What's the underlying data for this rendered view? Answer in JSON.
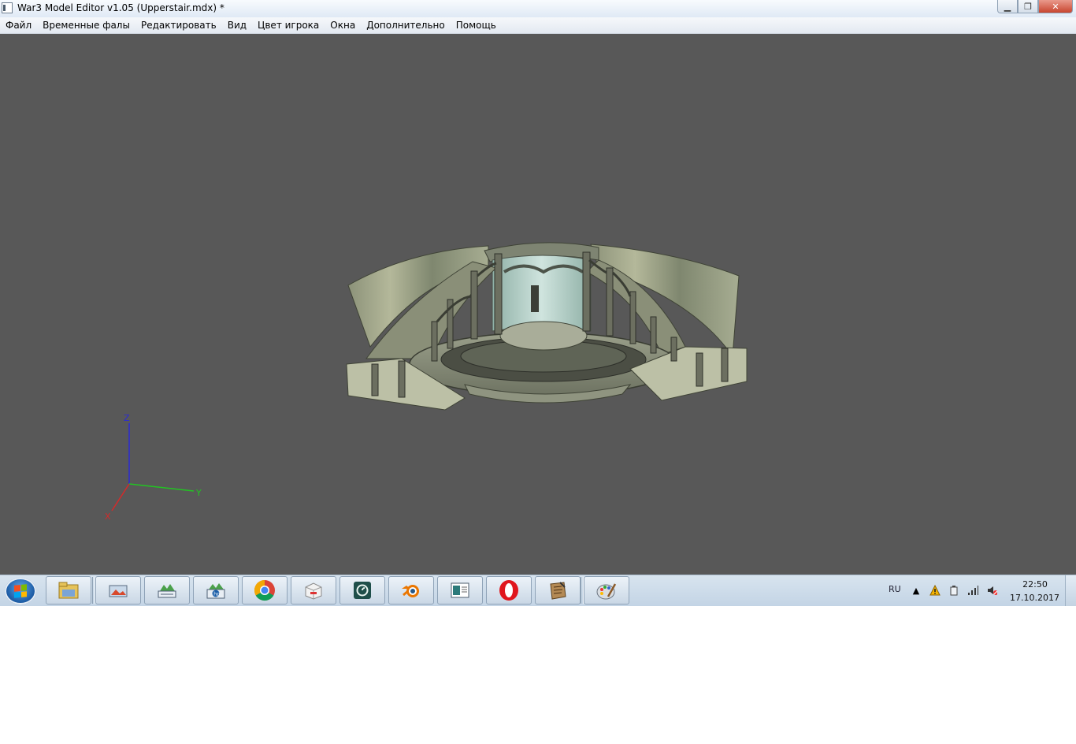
{
  "window": {
    "title": "War3 Model Editor v1.05 (Upperstair.mdx) *",
    "controls": {
      "minimize": "▁",
      "maximize": "❐",
      "close": "✕"
    }
  },
  "menu": [
    "Файл",
    "Временные фалы",
    "Редактировать",
    "Вид",
    "Цвет игрока",
    "Окна",
    "Дополнительно",
    "Помощь"
  ],
  "viewport": {
    "background": "#585858",
    "axes": {
      "x_label": "X",
      "y_label": "Y",
      "z_label": "Z",
      "x_color": "#d42a2a",
      "y_color": "#22c322",
      "z_color": "#2a2ad4"
    }
  },
  "taskbar": {
    "apps": [
      "windows-explorer-icon",
      "photo-viewer-icon",
      "scanner-icon",
      "hp-icon",
      "chrome-icon",
      "box-app-icon",
      "swirl-app-icon",
      "blender-icon",
      "slide-viewer-icon",
      "opera-icon",
      "scroll-app-icon",
      "paint-icon"
    ],
    "tray": {
      "language": "RU",
      "time": "22:50",
      "date": "17.10.2017"
    }
  }
}
